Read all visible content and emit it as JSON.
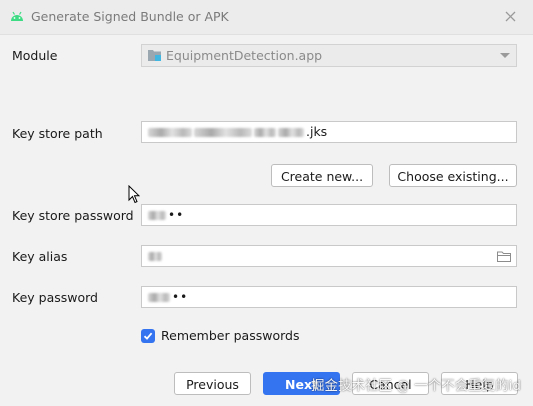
{
  "window": {
    "title": "Generate Signed Bundle or APK",
    "close_icon": "close-icon",
    "app_icon": "android-icon"
  },
  "module": {
    "label": "Module",
    "value": "EquipmentDetection.app",
    "icon": "module-icon"
  },
  "key_store_path": {
    "label": "Key store path",
    "value_suffix": ".jks"
  },
  "buttons": {
    "create_new": "Create new...",
    "choose_existing": "Choose existing...",
    "previous": "Previous",
    "next": "Next",
    "cancel": "Cancel",
    "help": "Help"
  },
  "key_store_password": {
    "label": "Key store password",
    "masked": "••"
  },
  "key_alias": {
    "label": "Key alias",
    "icon": "folder-icon"
  },
  "key_password": {
    "label": "Key password",
    "masked": "••"
  },
  "remember_passwords": {
    "label": "Remember passwords",
    "checked": true
  },
  "watermark": "掘金技术社区 @ 一个不会重复的id",
  "colors": {
    "accent": "#3574f0",
    "background": "#f2f2f2",
    "field_border": "#c9c9c9"
  }
}
